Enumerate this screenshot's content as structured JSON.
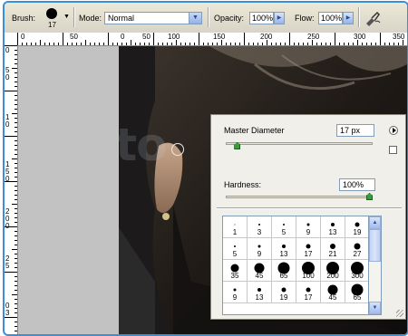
{
  "options_bar": {
    "brush_label": "Brush:",
    "brush_size": "17",
    "mode_label": "Mode:",
    "mode_value": "Normal",
    "opacity_label": "Opacity:",
    "opacity_value": "100%",
    "flow_label": "Flow:",
    "flow_value": "100%",
    "airbrush_icon": "airbrush-icon"
  },
  "ruler_top": [
    "0",
    "50",
    "0",
    "50",
    "100",
    "150",
    "200",
    "250",
    "300",
    "350"
  ],
  "ruler_left": [
    "0",
    "5",
    "0",
    "1",
    "0",
    "1",
    "5",
    "0",
    "2",
    "0",
    "0",
    "2",
    "5",
    "0",
    "3"
  ],
  "brush_panel": {
    "master_diameter_label": "Master Diameter",
    "master_diameter_value": "17 px",
    "master_diameter_level": 0.06,
    "hardness_label": "Hardness:",
    "hardness_value": "100%",
    "hardness_level": 1.0,
    "presets": [
      {
        "label": "1",
        "dot": 1
      },
      {
        "label": "3",
        "dot": 2
      },
      {
        "label": "5",
        "dot": 2
      },
      {
        "label": "9",
        "dot": 3
      },
      {
        "label": "13",
        "dot": 4
      },
      {
        "label": "19",
        "dot": 5
      },
      {
        "label": "5",
        "dot": 2
      },
      {
        "label": "9",
        "dot": 3
      },
      {
        "label": "13",
        "dot": 4
      },
      {
        "label": "17",
        "dot": 5
      },
      {
        "label": "21",
        "dot": 6
      },
      {
        "label": "27",
        "dot": 7
      },
      {
        "label": "35",
        "dot": 9
      },
      {
        "label": "45",
        "dot": 11
      },
      {
        "label": "65",
        "dot": 13
      },
      {
        "label": "100",
        "dot": 14
      },
      {
        "label": "200",
        "dot": 14
      },
      {
        "label": "300",
        "dot": 14
      },
      {
        "label": "9",
        "dot": 3
      },
      {
        "label": "13",
        "dot": 4
      },
      {
        "label": "19",
        "dot": 5
      },
      {
        "label": "17",
        "dot": 5
      },
      {
        "label": "45",
        "dot": 11
      },
      {
        "label": "65",
        "dot": 13
      }
    ]
  },
  "colors": {
    "frame_border": "#3c8fd4",
    "slider_thumb": "#3c9b3c"
  }
}
